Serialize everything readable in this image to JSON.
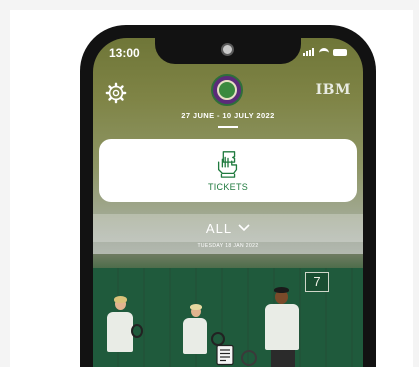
{
  "status_bar": {
    "time": "13:00"
  },
  "header": {
    "settings_icon": "gear-icon",
    "logo_icon": "wimbledon-logo",
    "brand": "IBM",
    "dates": "27 JUNE - 10 JULY 2022"
  },
  "tickets": {
    "label": "TICKETS",
    "icon": "ticket-hand-icon",
    "accent": "#1f7a3e"
  },
  "filter": {
    "label": "ALL",
    "icon": "chevron-down-icon"
  },
  "feed": {
    "day": "TUESDAY 18 JAN 2022",
    "photo": {
      "court_number": "7"
    },
    "item_icon": "article-icon"
  }
}
